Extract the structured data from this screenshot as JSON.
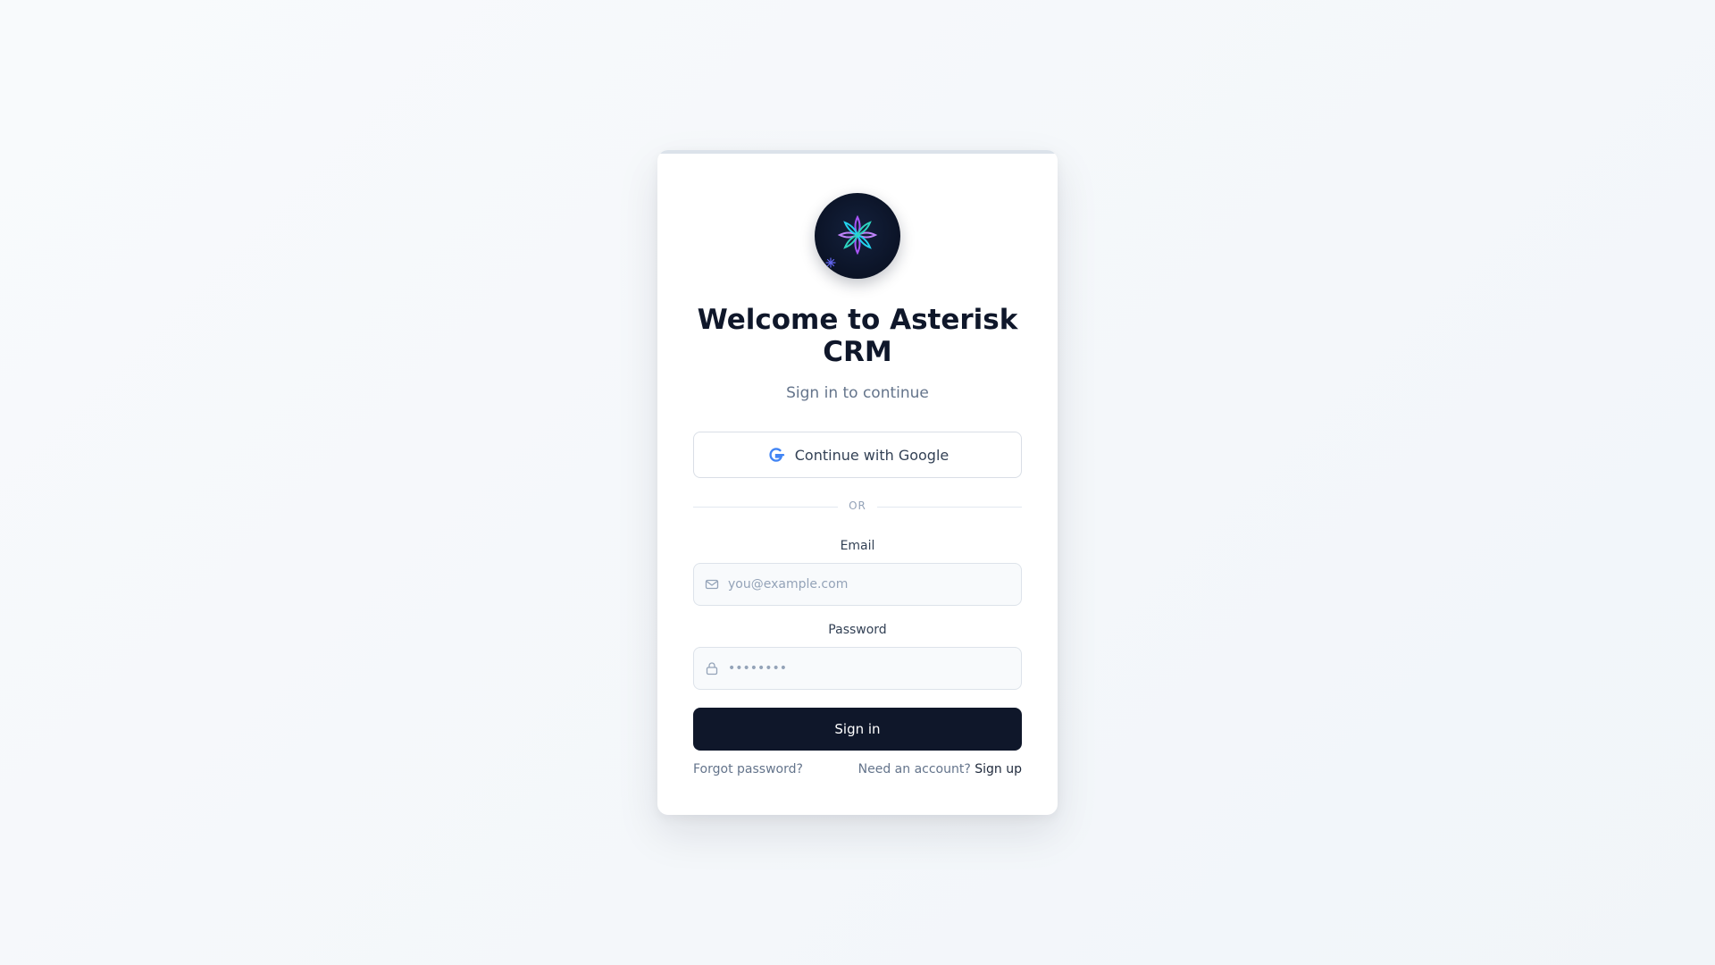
{
  "brand": {
    "logo_icon": "asterisk-icon",
    "accent_colors": [
      "#a855f7",
      "#22d3ee",
      "#0b1326"
    ]
  },
  "header": {
    "title": "Welcome to Asterisk CRM",
    "subtitle": "Sign in to continue"
  },
  "oauth": {
    "google_label": "Continue with Google",
    "google_icon": "google-icon"
  },
  "divider": {
    "label": "OR"
  },
  "form": {
    "email": {
      "label": "Email",
      "placeholder": "you@example.com",
      "value": "",
      "icon": "mail-icon"
    },
    "password": {
      "label": "Password",
      "placeholder": "••••••••",
      "value": "",
      "icon": "lock-icon"
    },
    "submit_label": "Sign in"
  },
  "footer": {
    "forgot_label": "Forgot password?",
    "need_account_label": "Need an account?",
    "signup_label": "Sign up"
  },
  "colors": {
    "primary_button": "#0f172a",
    "background": "#f8fafc"
  }
}
